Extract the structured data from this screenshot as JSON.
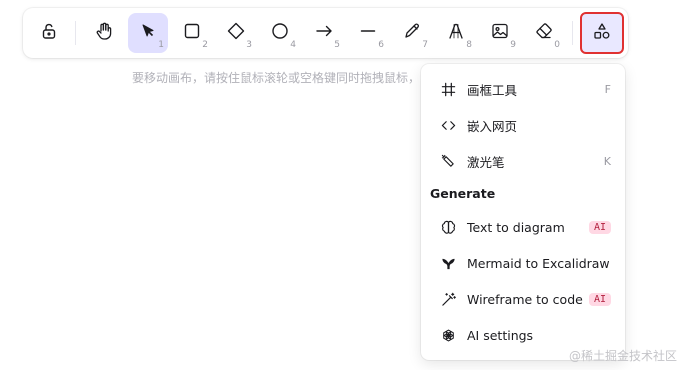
{
  "toolbar": {
    "tools": [
      {
        "name": "lock",
        "key": ""
      },
      {
        "name": "hand",
        "key": ""
      },
      {
        "name": "selection",
        "key": "1"
      },
      {
        "name": "rectangle",
        "key": "2"
      },
      {
        "name": "diamond",
        "key": "3"
      },
      {
        "name": "ellipse",
        "key": "4"
      },
      {
        "name": "arrow",
        "key": "5"
      },
      {
        "name": "line",
        "key": "6"
      },
      {
        "name": "draw",
        "key": "7"
      },
      {
        "name": "text",
        "key": "8"
      },
      {
        "name": "image",
        "key": "9"
      },
      {
        "name": "eraser",
        "key": "0"
      },
      {
        "name": "more-tools",
        "key": ""
      }
    ],
    "active_tool": "selection",
    "highlighted_tool": "more-tools"
  },
  "hint": "要移动画布，请按住鼠标滚轮或空格键同时拖拽鼠标，",
  "dropdown": {
    "items": [
      {
        "label": "画框工具",
        "shortcut": "F",
        "icon": "frame-icon"
      },
      {
        "label": "嵌入网页",
        "shortcut": "",
        "icon": "embed-icon"
      },
      {
        "label": "激光笔",
        "shortcut": "K",
        "icon": "laser-icon"
      }
    ],
    "generate_title": "Generate",
    "generate_items": [
      {
        "label": "Text to diagram",
        "badge": "AI",
        "icon": "brain-icon"
      },
      {
        "label": "Mermaid to Excalidraw",
        "badge": "",
        "icon": "mermaid-icon"
      },
      {
        "label": "Wireframe to code",
        "badge": "AI",
        "icon": "magic-wand-icon"
      },
      {
        "label": "AI settings",
        "badge": "",
        "icon": "openai-icon"
      }
    ]
  },
  "watermark": "@稀土掘金技术社区",
  "colors": {
    "active_bg": "#e0dfff",
    "highlight_border": "#e03131",
    "ai_badge_bg": "#ffd8e4",
    "ai_badge_text": "#b3213f"
  }
}
